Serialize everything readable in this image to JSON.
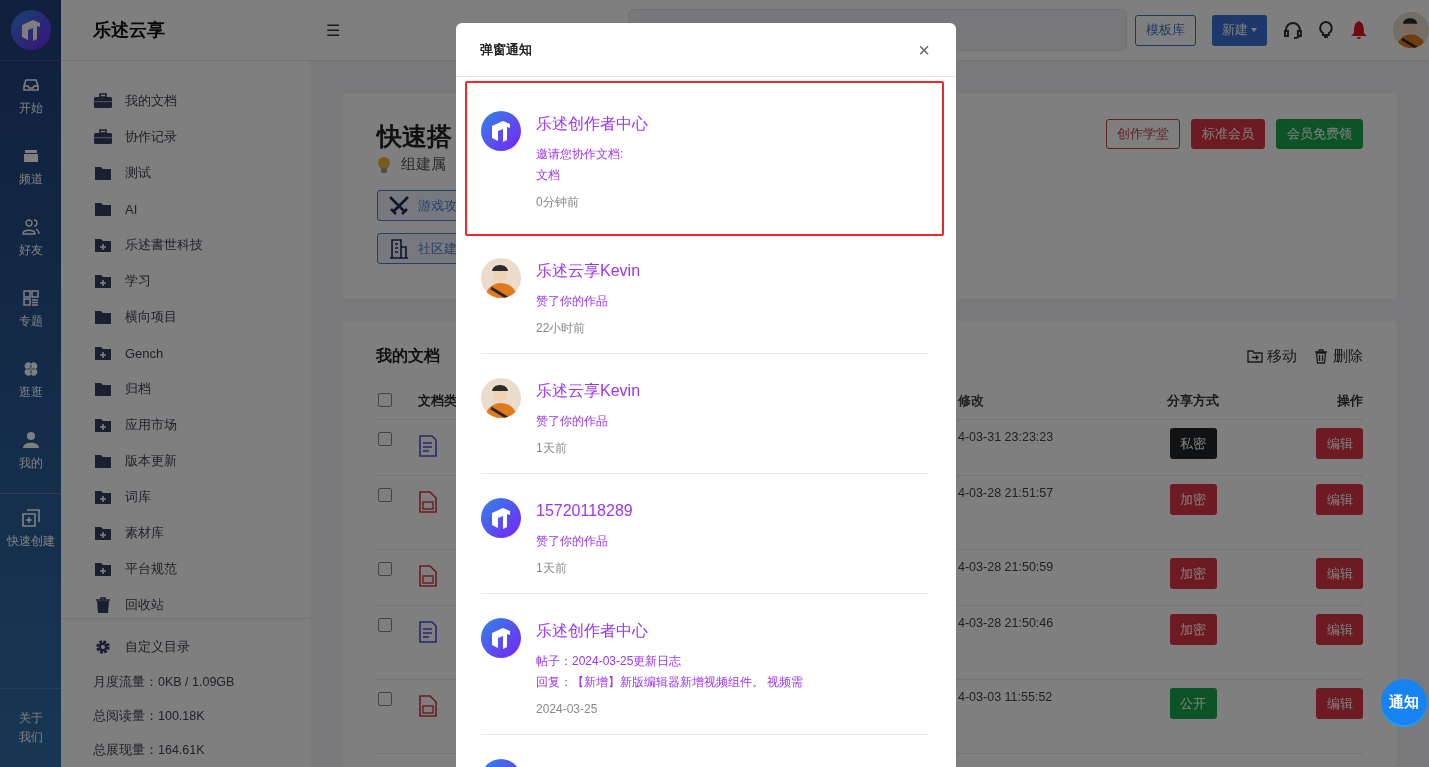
{
  "rail": {
    "items": [
      {
        "kind": "inbox",
        "label": "开始"
      },
      {
        "kind": "shop",
        "label": "频道"
      },
      {
        "kind": "users",
        "label": "好友"
      },
      {
        "kind": "grid",
        "label": "专题"
      },
      {
        "kind": "clover",
        "label": "逛逛"
      },
      {
        "kind": "user",
        "label": "我的"
      },
      {
        "kind": "add",
        "label": "快速创建"
      }
    ],
    "about": "关于我们"
  },
  "sidebar": {
    "brand": "乐述云享",
    "items": [
      {
        "kind": "briefcase",
        "label": "我的文档"
      },
      {
        "kind": "briefcase",
        "label": "协作记录"
      },
      {
        "kind": "folder",
        "label": "测试"
      },
      {
        "kind": "folder",
        "label": "AI"
      },
      {
        "kind": "folder-plus",
        "label": "乐述書世科技"
      },
      {
        "kind": "folder-plus",
        "label": "学习"
      },
      {
        "kind": "folder",
        "label": "横向项目"
      },
      {
        "kind": "folder-plus",
        "label": "Gench"
      },
      {
        "kind": "folder",
        "label": "归档"
      },
      {
        "kind": "folder-plus",
        "label": "应用市场"
      },
      {
        "kind": "folder",
        "label": "版本更新"
      },
      {
        "kind": "folder-plus",
        "label": "词库"
      },
      {
        "kind": "folder-plus",
        "label": "素材库"
      },
      {
        "kind": "folder-plus",
        "label": "平台规范"
      },
      {
        "kind": "trash",
        "label": "回收站"
      }
    ],
    "settings": "自定义目录",
    "stats": [
      "月度流量：0KB / 1.09GB",
      "总阅读量：100.18K",
      "总展现量：164.61K"
    ]
  },
  "topbar": {
    "menu": "☰",
    "buttons": [
      {
        "kind": "outline",
        "label": "模板库"
      },
      {
        "kind": "dropdown",
        "label": "新建"
      }
    ]
  },
  "hero": {
    "title": "快速搭",
    "tip": "组建属",
    "shortcuts": [
      {
        "kind": "swords",
        "label": "游戏攻"
      },
      {
        "kind": "building",
        "label": "社区建"
      }
    ],
    "actions": [
      {
        "kind": "outline",
        "label": "创作学堂"
      },
      {
        "kind": "danger",
        "label": "标准会员"
      },
      {
        "kind": "success",
        "label": "会员免费领"
      }
    ]
  },
  "docs": {
    "title": "我的文档",
    "tools": [
      {
        "kind": "move",
        "label": "移动"
      },
      {
        "kind": "delete",
        "label": "删除"
      }
    ],
    "columns": [
      "文档类",
      "修改",
      "分享方式",
      "操作"
    ],
    "header_checked": false,
    "rows": [
      {
        "checked": false,
        "kind": "doc",
        "modified": "4-03-31 23:23:23",
        "share": {
          "kind": "private",
          "label": "私密"
        },
        "action": "编辑",
        "tall": false
      },
      {
        "checked": false,
        "kind": "md",
        "modified": "4-03-28 21:51:57",
        "share": {
          "kind": "encrypted",
          "label": "加密"
        },
        "action": "编辑",
        "tall": true
      },
      {
        "checked": false,
        "kind": "md",
        "modified": "4-03-28 21:50:59",
        "share": {
          "kind": "encrypted",
          "label": "加密"
        },
        "action": "编辑",
        "tall": false
      },
      {
        "checked": false,
        "kind": "doc",
        "modified": "4-03-28 21:50:46",
        "share": {
          "kind": "encrypted",
          "label": "加密"
        },
        "action": "编辑",
        "tall": true
      },
      {
        "checked": false,
        "kind": "md",
        "modified": "4-03-03 11:55:52",
        "share": {
          "kind": "public",
          "label": "公开"
        },
        "action": "编辑",
        "tall": true
      }
    ]
  },
  "float_button": "通知",
  "modal": {
    "title": "弹窗通知",
    "close": "×",
    "items": [
      {
        "kind": "logo",
        "highlighted": true,
        "sender": "乐述创作者中心",
        "lines": [
          "邀请您协作文档:",
          "文档"
        ],
        "time": "0分钟前"
      },
      {
        "highlighted": false,
        "sender": "乐述云享Kevin",
        "lines": [
          "赞了你的作品"
        ],
        "time": "22小时前"
      },
      {
        "highlighted": false,
        "sender": "乐述云享Kevin",
        "lines": [
          "赞了你的作品"
        ],
        "time": "1天前"
      },
      {
        "kind": "logo",
        "highlighted": false,
        "sender": "15720118289",
        "lines": [
          "赞了你的作品"
        ],
        "time": "1天前"
      },
      {
        "kind": "logo",
        "highlighted": false,
        "sender": "乐述创作者中心",
        "lines": [
          "帖子：2024-03-25更新日志",
          "回复：【新增】新版编辑器新增视频组件。 视频需"
        ],
        "time": "2024-03-25"
      },
      {
        "kind": "logo",
        "highlighted": false
      }
    ]
  }
}
